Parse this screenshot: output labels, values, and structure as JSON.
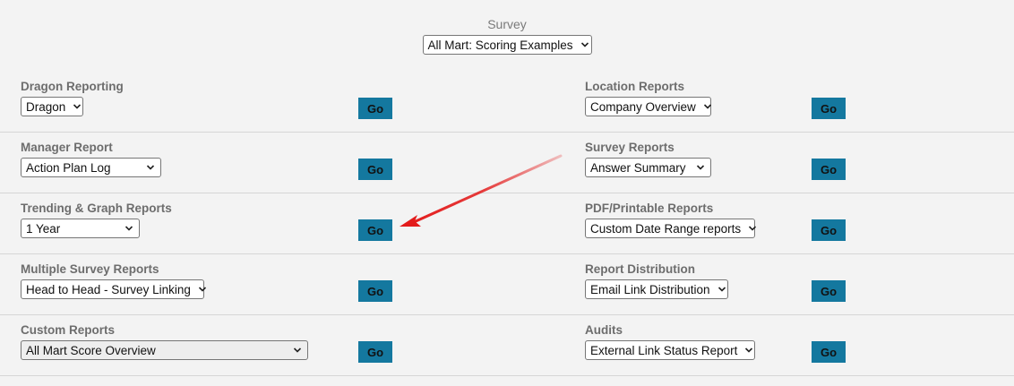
{
  "survey": {
    "label": "Survey",
    "selected": "All Mart: Scoring Examples"
  },
  "go_label": "Go",
  "rows": [
    {
      "left": {
        "label": "Dragon Reporting",
        "selected": "Dragon"
      },
      "right": {
        "label": "Location Reports",
        "selected": "Company Overview"
      }
    },
    {
      "left": {
        "label": "Manager Report",
        "selected": "Action Plan Log"
      },
      "right": {
        "label": "Survey Reports",
        "selected": "Answer Summary"
      }
    },
    {
      "left": {
        "label": "Trending & Graph Reports",
        "selected": "1 Year"
      },
      "right": {
        "label": "PDF/Printable Reports",
        "selected": "Custom Date Range reports"
      }
    },
    {
      "left": {
        "label": "Multiple Survey Reports",
        "selected": "Head to Head - Survey Linking"
      },
      "right": {
        "label": "Report Distribution",
        "selected": "Email Link Distribution"
      }
    },
    {
      "left": {
        "label": "Custom Reports",
        "selected": "All Mart Score Overview"
      },
      "right": {
        "label": "Audits",
        "selected": "External Link Status Report"
      }
    }
  ],
  "colors": {
    "go_button": "#14789f",
    "annotation_arrow": "#e31b1b"
  },
  "icons": {
    "dropdown": "chevron-down-icon",
    "annotation": "red-arrow-icon"
  }
}
